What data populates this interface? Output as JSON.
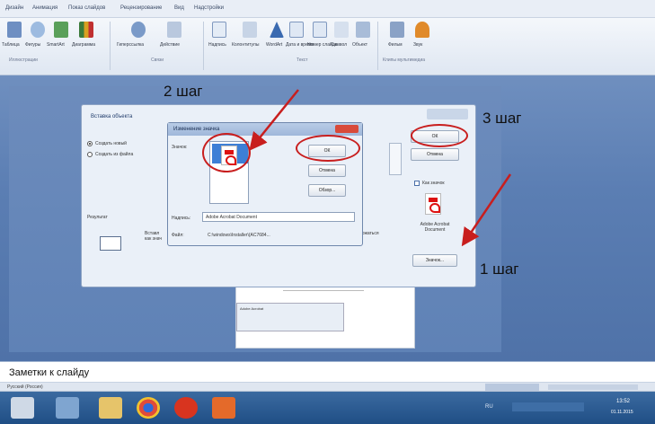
{
  "ribbon": {
    "tabs": [
      "Дизайн",
      "Анимация",
      "Показ слайдов",
      "Рецензирование",
      "Вид",
      "Надстройки"
    ],
    "buttons": [
      "Таблица",
      "Фигуры",
      "SmartArt",
      "Диаграмма",
      "Гиперссылка",
      "Действие",
      "Надпись",
      "Колонтитулы",
      "WordArt",
      "Дата и время",
      "Номер слайда",
      "Символ",
      "Объект",
      "Фильм",
      "Звук"
    ],
    "groups": [
      "Иллюстрации",
      "Связи",
      "Текст",
      "Клипы мультимедиа"
    ]
  },
  "insert_dialog": {
    "title": "Вставка объекта",
    "radio_new": "Создать новый",
    "radio_file": "Создать из файла",
    "ok": "ОК",
    "cancel": "Отмена",
    "as_icon": "Как значок",
    "icon_caption": "Adobe Acrobat Document",
    "change_icon": "Значок...",
    "result_label": "Результат",
    "result_text_1": "Вставл",
    "result_text_2": "как знач",
    "result_text_3": "держаться"
  },
  "change_icon_dialog": {
    "title": "Изменение значка",
    "icon_label": "Значок:",
    "ok": "ОК",
    "cancel": "Отмена",
    "browse": "Обзор...",
    "caption_label": "Надпись:",
    "caption_value": "Adobe Acrobat Document",
    "file_label": "Файл:",
    "file_value": "C:\\windows\\Installer\\{AC7684..."
  },
  "annotations": {
    "step1": "1 шаг",
    "step2": "2 шаг",
    "step3": "3 шаг"
  },
  "slide": {
    "thumb_text": "Adobe Acrobat"
  },
  "notes": {
    "label": "Заметки к слайду"
  },
  "status": {
    "language": "Русский (Россия)"
  },
  "taskbar": {
    "lang": "RU",
    "time": "13:52",
    "date": "01.11.2015"
  },
  "colors": {
    "annotation_red": "#c81e1e",
    "taskbar": "#2a5a92",
    "workspace": "#5f82b6"
  }
}
